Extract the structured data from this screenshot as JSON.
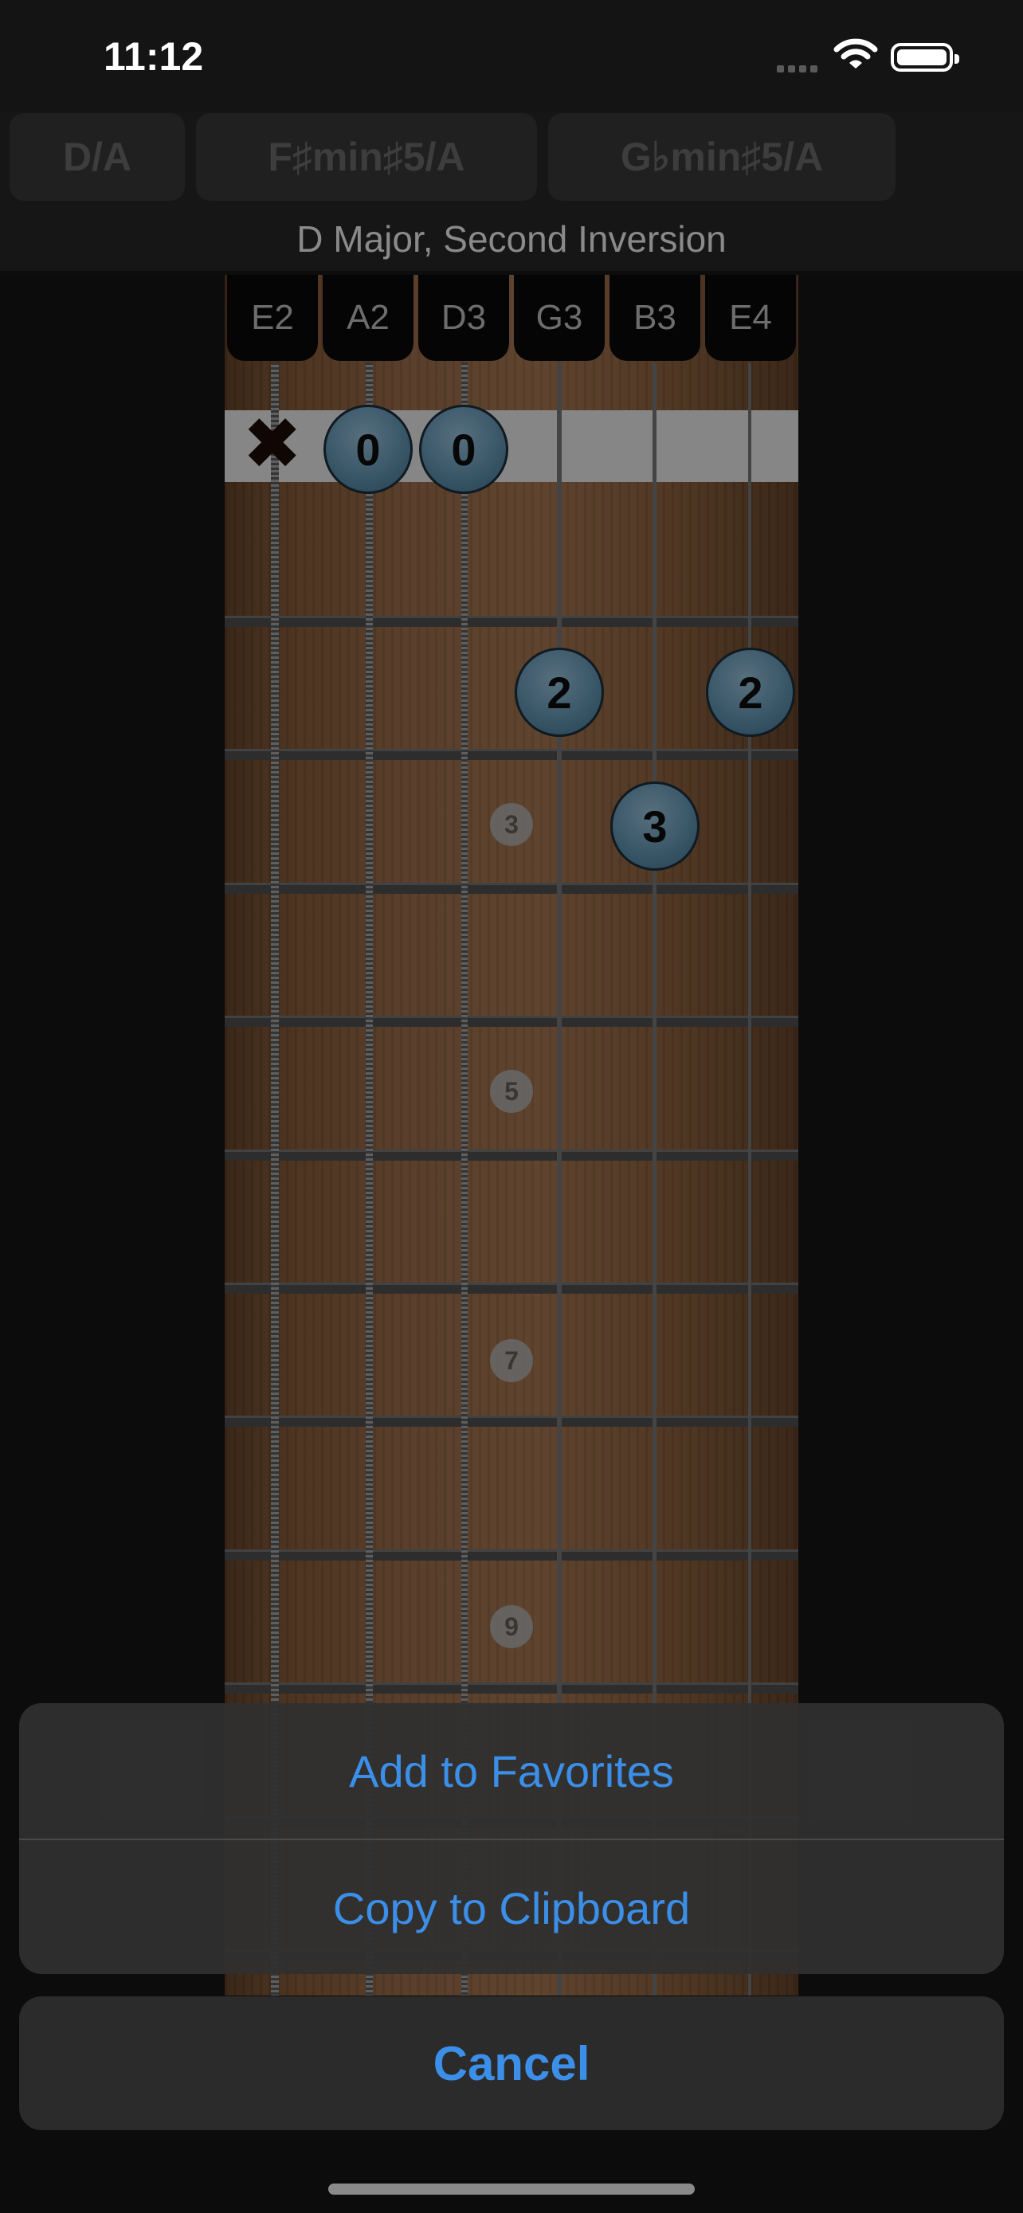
{
  "status_bar": {
    "time": "11:12"
  },
  "chips": [
    "D/A",
    "F♯min♯5/A",
    "G♭min♯5/A"
  ],
  "chord_name": "D Major, Second Inversion",
  "strings": [
    "E2",
    "A2",
    "D3",
    "G3",
    "B3",
    "E4"
  ],
  "fret_markers": [
    "3",
    "5",
    "7",
    "9"
  ],
  "fingering": {
    "mute_symbol": "✖",
    "open_1": "0",
    "open_2": "0",
    "g3": "2",
    "e4": "2",
    "b3": "3"
  },
  "action_sheet": {
    "add_favorites": "Add to Favorites",
    "copy_clipboard": "Copy to Clipboard",
    "cancel": "Cancel"
  },
  "colors": {
    "accent": "#3b8fe8",
    "finger_dot": "#5e8da9",
    "background": "#141414"
  }
}
